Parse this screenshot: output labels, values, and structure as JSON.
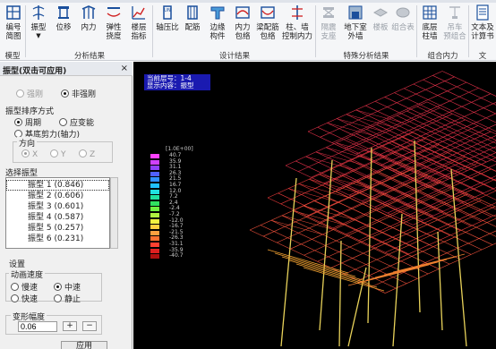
{
  "ribbon": {
    "buttons": [
      {
        "id": "bianhao",
        "label1": "编号",
        "label2": "简图",
        "icon": "numbering-diagram-icon",
        "disabled": false
      },
      {
        "id": "zhenxing",
        "label1": "振型",
        "label2": "▼",
        "icon": "mode-shape-icon",
        "disabled": false
      },
      {
        "id": "weiyi",
        "label1": "位移",
        "label2": "",
        "icon": "displacement-icon",
        "disabled": false
      },
      {
        "id": "neili",
        "label1": "内力",
        "label2": "",
        "icon": "internal-force-icon",
        "disabled": false
      },
      {
        "id": "tanxing",
        "label1": "弹性",
        "label2": "挠度",
        "icon": "elastic-deflection-icon",
        "disabled": false
      },
      {
        "id": "louceng",
        "label1": "楼层",
        "label2": "指标",
        "icon": "floor-index-icon",
        "disabled": false
      },
      {
        "id": "zhouya",
        "label1": "轴压比",
        "label2": "",
        "icon": "axial-ratio-icon",
        "disabled": false
      },
      {
        "id": "peijin",
        "label1": "配筋",
        "label2": "",
        "icon": "reinforcement-icon",
        "disabled": false
      },
      {
        "id": "bianyuan",
        "label1": "边缘",
        "label2": "构件",
        "icon": "edge-member-icon",
        "disabled": false
      },
      {
        "id": "neilibaoluo",
        "label1": "内力",
        "label2": "包络",
        "icon": "force-envelope-icon",
        "disabled": false
      },
      {
        "id": "liangpeijin",
        "label1": "梁配筋",
        "label2": "包络",
        "icon": "beam-envelope-icon",
        "disabled": false
      },
      {
        "id": "zhuqiang",
        "label1": "柱、墙",
        "label2": "控制内力",
        "icon": "column-wall-control-icon",
        "disabled": false
      },
      {
        "id": "geizhen",
        "label1": "隔震",
        "label2": "支座",
        "icon": "isolation-bearing-icon",
        "disabled": true
      },
      {
        "id": "dixiashi",
        "label1": "地下室",
        "label2": "外墙",
        "icon": "basement-wall-icon",
        "disabled": false
      },
      {
        "id": "louban",
        "label1": "楼板",
        "label2": "",
        "icon": "slab-icon",
        "disabled": true
      },
      {
        "id": "zuhe",
        "label1": "组合表",
        "label2": "",
        "icon": "combo-table-icon",
        "disabled": true
      },
      {
        "id": "dicheng",
        "label1": "底层",
        "label2": "柱墙",
        "icon": "base-column-wall-icon",
        "disabled": false
      },
      {
        "id": "diaoche",
        "label1": "吊车",
        "label2": "预组合",
        "icon": "crane-precombo-icon",
        "disabled": true
      },
      {
        "id": "wenben",
        "label1": "文本及",
        "label2": "计算书",
        "icon": "text-report-icon",
        "disabled": false
      }
    ],
    "groups": [
      {
        "id": "model",
        "label": "模型"
      },
      {
        "id": "analysis",
        "label": "分析结果"
      },
      {
        "id": "design",
        "label": "设计结果"
      },
      {
        "id": "special",
        "label": "特殊分析结果"
      },
      {
        "id": "combo",
        "label": "组合内力"
      },
      {
        "id": "text",
        "label": "文"
      }
    ]
  },
  "panel": {
    "title": "振型(双击可应用)",
    "close": "×",
    "rigid": {
      "option1": "强刚",
      "option2": "非强刚",
      "selected": "非强刚"
    },
    "sort": {
      "label": "振型排序方式",
      "option1": "周期",
      "option2": "应变能",
      "option3": "基底剪力(轴力)",
      "selected": "周期"
    },
    "direction": {
      "label": "方向",
      "options": [
        "X",
        "Y",
        "Z"
      ]
    },
    "select_label": "选择振型",
    "modes": [
      "振型 1 (0.846)",
      "振型 2 (0.606)",
      "振型 3 (0.601)",
      "振型 4 (0.587)",
      "振型 5 (0.257)",
      "振型 6 (0.231)"
    ],
    "settings": {
      "label": "设置",
      "speed_label": "动画速度",
      "slow": "慢速",
      "medium": "中速",
      "fast": "快速",
      "still": "静止",
      "speed_selected": "中速",
      "amp_label": "变形幅度",
      "amp_value": "0.06",
      "plus": "+",
      "minus": "−",
      "apply": "应用"
    }
  },
  "viewport": {
    "info_line1": "当前层号：1-4",
    "info_line2": "显示内容：振型",
    "scale_title": "[1.0E+00]",
    "scale": [
      {
        "label": "40.7",
        "color": "#ff40ff"
      },
      {
        "label": "35.9",
        "color": "#d040ff"
      },
      {
        "label": "31.1",
        "color": "#9040ff"
      },
      {
        "label": "26.3",
        "color": "#5060ff"
      },
      {
        "label": "21.5",
        "color": "#3090ff"
      },
      {
        "label": "16.7",
        "color": "#20c0ff"
      },
      {
        "label": "12.0",
        "color": "#20e0e0"
      },
      {
        "label": "7.2",
        "color": "#20e0a0"
      },
      {
        "label": "2.4",
        "color": "#30e060"
      },
      {
        "label": "-2.4",
        "color": "#70f040"
      },
      {
        "label": "-7.2",
        "color": "#b0f040"
      },
      {
        "label": "-12.0",
        "color": "#f0f040"
      },
      {
        "label": "-16.7",
        "color": "#ffd040"
      },
      {
        "label": "-21.5",
        "color": "#ffa040"
      },
      {
        "label": "-26.3",
        "color": "#ff7030"
      },
      {
        "label": "-31.1",
        "color": "#ff4030"
      },
      {
        "label": "-35.9",
        "color": "#e02020"
      },
      {
        "label": "-40.7",
        "color": "#b01010"
      }
    ]
  }
}
